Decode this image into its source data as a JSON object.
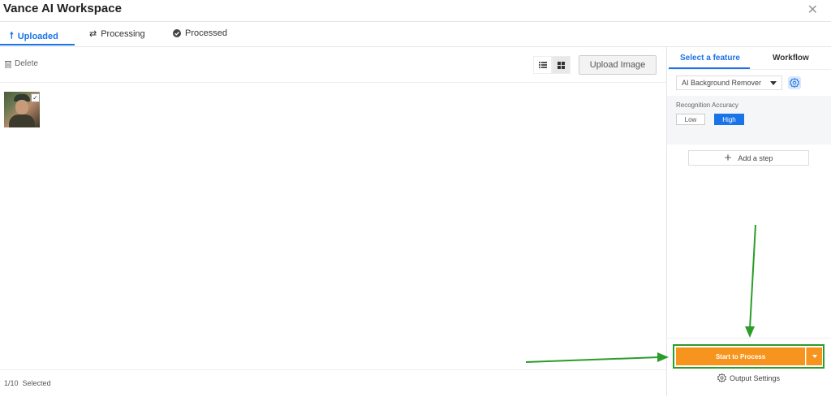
{
  "header": {
    "title": "Vance AI Workspace",
    "close_icon": "close-icon"
  },
  "tabs": [
    {
      "label": "Uploaded",
      "icon": "upload-arrow-icon",
      "active": true
    },
    {
      "label": "Processing",
      "icon": "refresh-icon",
      "active": false
    },
    {
      "label": "Processed",
      "icon": "check-circle-icon",
      "active": false
    }
  ],
  "toolbar": {
    "delete_label": "Delete",
    "upload_label": "Upload Image",
    "view_mode": "grid"
  },
  "images": [
    {
      "selected": true
    }
  ],
  "footer": {
    "selected_count": "1/10",
    "selected_label": "Selected"
  },
  "right_panel": {
    "tabs": [
      "Select a feature",
      "Workflow"
    ],
    "active_tab": "Select a feature",
    "feature": {
      "selected": "AI Background Remover"
    },
    "accuracy": {
      "label": "Recognition Accuracy",
      "options": [
        "Low",
        "High"
      ],
      "selected": "High"
    },
    "add_step_label": "Add a step",
    "process_label": "Start to Process",
    "output_settings_label": "Output Settings"
  },
  "colors": {
    "accent": "#1a73e8",
    "process": "#f7941d",
    "highlight": "#2a9d2a"
  }
}
